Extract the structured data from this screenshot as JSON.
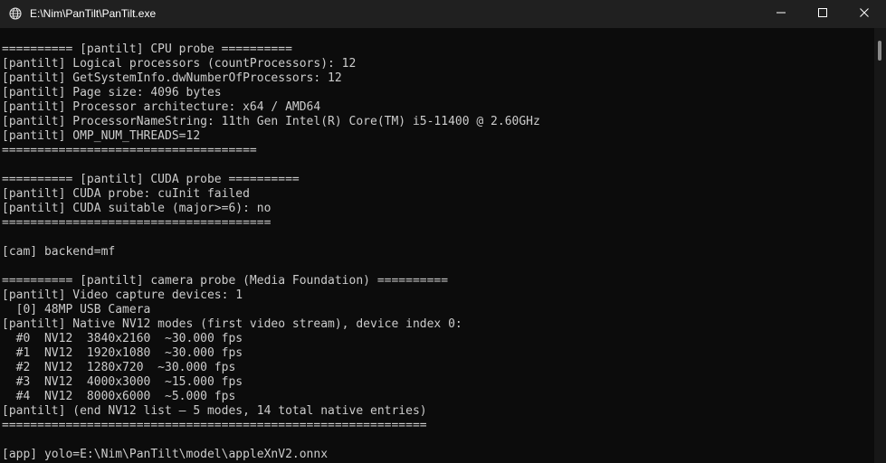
{
  "window": {
    "title": "E:\\Nim\\PanTilt\\PanTilt.exe"
  },
  "icons": {
    "app": "globe-icon",
    "minimize": "minimize-icon",
    "maximize": "maximize-icon",
    "close": "close-icon"
  },
  "colors": {
    "background": "#0c0c0c",
    "text": "#cccccc",
    "titlebar": "#202020"
  },
  "console": {
    "lines": [
      "========== [pantilt] CPU probe ==========",
      "[pantilt] Logical processors (countProcessors): 12",
      "[pantilt] GetSystemInfo.dwNumberOfProcessors: 12",
      "[pantilt] Page size: 4096 bytes",
      "[pantilt] Processor architecture: x64 / AMD64",
      "[pantilt] ProcessorNameString: 11th Gen Intel(R) Core(TM) i5-11400 @ 2.60GHz",
      "[pantilt] OMP_NUM_THREADS=12",
      "====================================",
      "",
      "========== [pantilt] CUDA probe ==========",
      "[pantilt] CUDA probe: cuInit failed",
      "[pantilt] CUDA suitable (major>=6): no",
      "======================================",
      "",
      "[cam] backend=mf",
      "",
      "========== [pantilt] camera probe (Media Foundation) ==========",
      "[pantilt] Video capture devices: 1",
      "  [0] 48MP USB Camera",
      "[pantilt] Native NV12 modes (first video stream), device index 0:",
      "  #0  NV12  3840x2160  ~30.000 fps",
      "  #1  NV12  1920x1080  ~30.000 fps",
      "  #2  NV12  1280x720  ~30.000 fps",
      "  #3  NV12  4000x3000  ~15.000 fps",
      "  #4  NV12  8000x6000  ~5.000 fps",
      "[pantilt] (end NV12 list — 5 modes, 14 total native entries)",
      "============================================================",
      "",
      "[app] yolo=E:\\Nim\\PanTilt\\model\\appleXnV2.onnx"
    ]
  }
}
